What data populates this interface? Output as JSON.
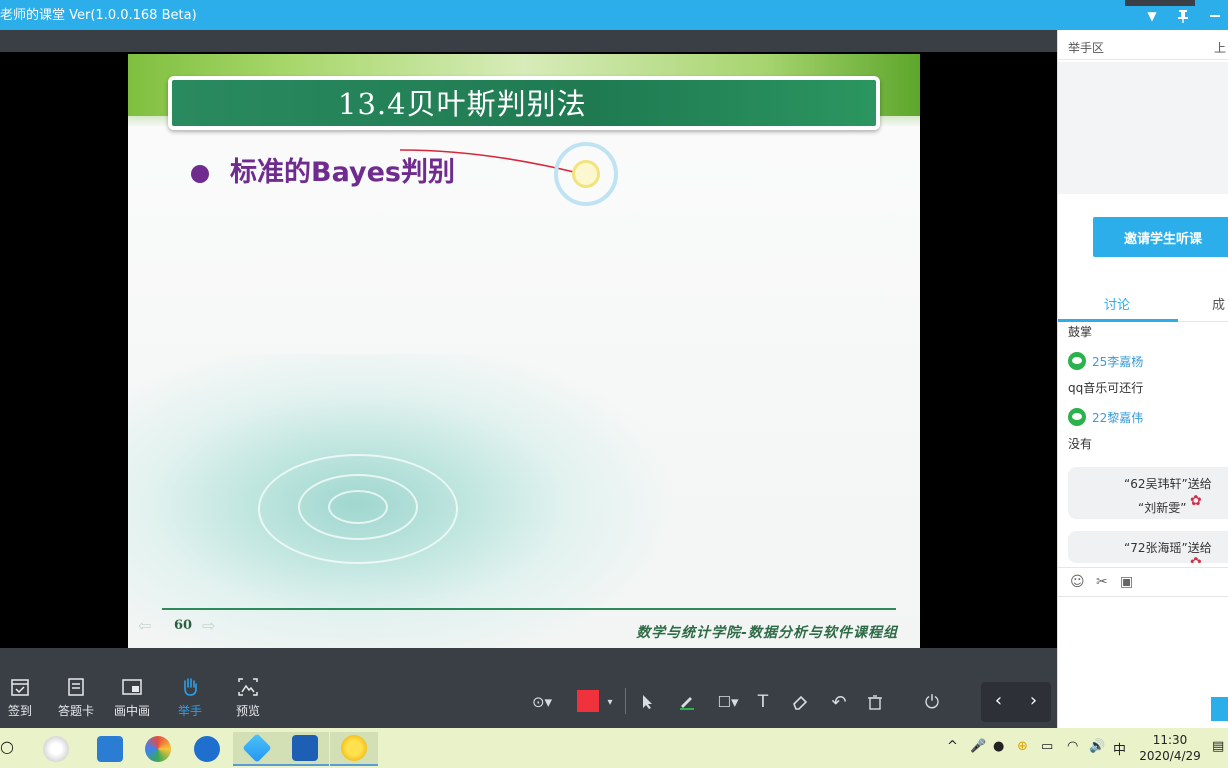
{
  "window": {
    "title": "老师的课堂 Ver(1.0.0.168 Beta)"
  },
  "slide": {
    "title": "13.4贝叶斯判别法",
    "bullet": "标准的Bayes判别",
    "page_number": "60",
    "footer": "数学与统计学院-数据分析与软件课程组"
  },
  "toolbar": {
    "items": [
      {
        "label": "签到",
        "icon": "calendar-check-icon"
      },
      {
        "label": "答题卡",
        "icon": "answer-card-icon"
      },
      {
        "label": "画中画",
        "icon": "picture-in-picture-icon"
      },
      {
        "label": "举手",
        "icon": "raise-hand-icon",
        "active": true
      },
      {
        "label": "预览",
        "icon": "preview-icon"
      }
    ],
    "pen_color": "#f0323c",
    "accent": "#2f9ee6"
  },
  "panel": {
    "raise_hand_label": "举手区",
    "upper_label": "上",
    "invite_label": "邀请学生听课",
    "tabs": [
      "讨论",
      "成"
    ],
    "messages": [
      {
        "type": "text",
        "text": "鼓掌"
      },
      {
        "type": "user",
        "name": "25李嘉杨"
      },
      {
        "type": "text",
        "text": "qq音乐可还行"
      },
      {
        "type": "user",
        "name": "22黎嘉伟"
      },
      {
        "type": "text",
        "text": "没有"
      }
    ],
    "gifts": [
      {
        "line1": "“62吴玮轩”送给",
        "line2": "“刘新雯”"
      },
      {
        "line1": "“72张海瑶”送给",
        "line2": ""
      }
    ]
  },
  "taskbar": {
    "ime": "中",
    "time": "11:30",
    "date": "2020/4/29"
  }
}
